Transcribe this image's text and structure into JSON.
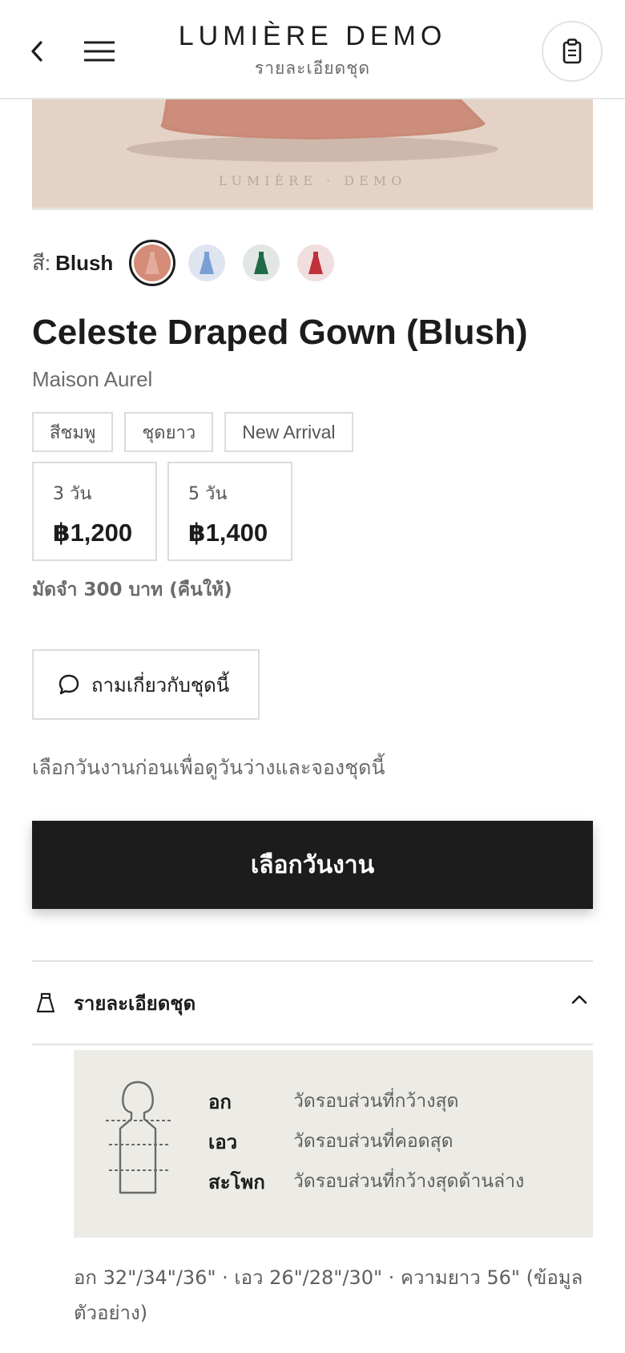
{
  "header": {
    "brand": "LUMIÈRE DEMO",
    "subtitle": "รายละเอียดชุด",
    "back_icon": "chevron-left-icon",
    "menu_icon": "hamburger-icon",
    "cart_icon": "rental-list-icon"
  },
  "hero": {
    "watermark": "LUMIÈRE · DEMO",
    "background": "#e5d2c6"
  },
  "color_selector": {
    "label": "สี:",
    "selected": "Blush",
    "swatches": [
      {
        "name": "Blush",
        "color": "#d48c78"
      },
      {
        "name": "Blue",
        "color": "#7a9fd6"
      },
      {
        "name": "Green",
        "color": "#1f6b47"
      },
      {
        "name": "Red",
        "color": "#c0313c"
      }
    ]
  },
  "product": {
    "title": "Celeste Draped Gown (Blush)",
    "designer": "Maison Aurel",
    "tags": [
      "สีชมพู",
      "ชุดยาว",
      "New Arrival"
    ],
    "prices": [
      {
        "days": "3 วัน",
        "amount": "฿1,200"
      },
      {
        "days": "5 วัน",
        "amount": "฿1,400"
      }
    ],
    "deposit": "มัดจำ 300 บาท (คืนให้)"
  },
  "ask_button": {
    "label": "ถามเกี่ยวกับชุดนี้",
    "icon": "chat-bubble-icon"
  },
  "hint": "เลือกวันงานก่อนเพื่อดูวันว่างและจองชุดนี้",
  "cta": {
    "label": "เลือกวันงาน"
  },
  "details": {
    "title": "รายละเอียดชุด",
    "icon": "dress-icon",
    "expanded_icon": "chevron-up-icon",
    "measurements": [
      {
        "name": "อก",
        "desc": "วัดรอบส่วนที่กว้างสุด"
      },
      {
        "name": "เอว",
        "desc": "วัดรอบส่วนที่คอดสุด"
      },
      {
        "name": "สะโพก",
        "desc": "วัดรอบส่วนที่กว้างสุดด้านล่าง"
      }
    ],
    "sizes": "อก 32\"/34\"/36\" · เอว 26\"/28\"/30\" · ความยาว 56\" (ข้อมูลตัวอย่าง)"
  },
  "colors": {
    "primary": "#1c1c1c",
    "muted_text": "#6b6b6b",
    "border": "#dcdcdc",
    "panel": "#ecebe6"
  }
}
